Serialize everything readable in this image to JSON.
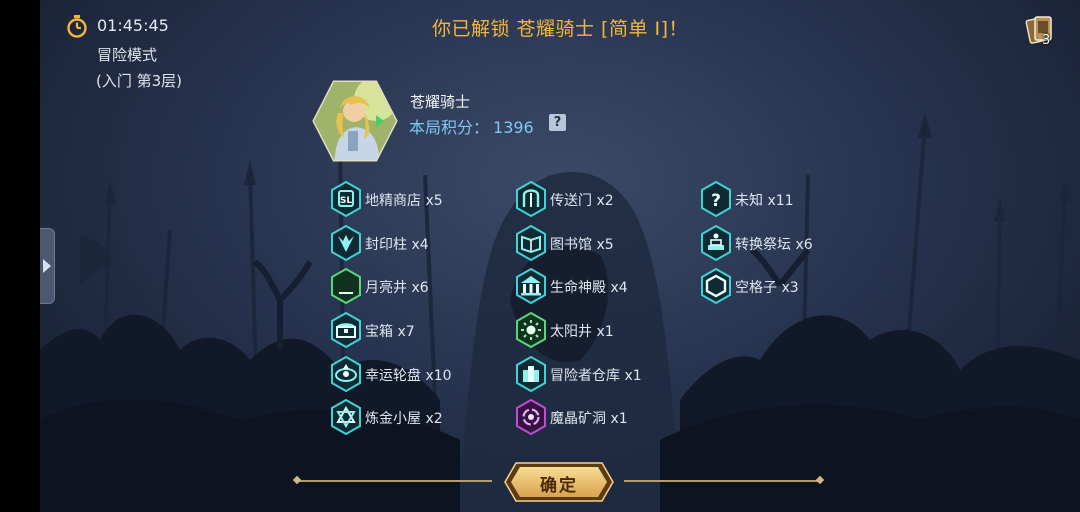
{
  "header": {
    "timer": "01:45:45",
    "mode": "冒险模式",
    "floor": "(入门 第3层)",
    "headline": "你已解锁 苍耀骑士 [简单 I]！",
    "card_count": "3"
  },
  "hero": {
    "name": "苍耀骑士",
    "score_label": "本局积分：",
    "score_value": "1396",
    "help": "?"
  },
  "rooms": [
    {
      "label": "地精商店 x5",
      "icon": "goblin-shop-icon"
    },
    {
      "label": "传送门 x2",
      "icon": "portal-icon"
    },
    {
      "label": "未知 x11",
      "icon": "unknown-icon"
    },
    {
      "label": "封印柱 x4",
      "icon": "seal-pillar-icon"
    },
    {
      "label": "图书馆 x5",
      "icon": "library-icon"
    },
    {
      "label": "转换祭坛 x6",
      "icon": "altar-icon"
    },
    {
      "label": "月亮井 x6",
      "icon": "moon-well-icon"
    },
    {
      "label": "生命神殿 x4",
      "icon": "life-temple-icon"
    },
    {
      "label": "空格子 x3",
      "icon": "empty-cell-icon"
    },
    {
      "label": "宝箱 x7",
      "icon": "chest-icon"
    },
    {
      "label": "太阳井 x1",
      "icon": "sun-well-icon"
    },
    {
      "label": "幸运轮盘 x10",
      "icon": "lucky-wheel-icon"
    },
    {
      "label": "冒险者仓库 x1",
      "icon": "warehouse-icon"
    },
    {
      "label": "炼金小屋 x2",
      "icon": "alchemy-icon"
    },
    {
      "label": "魔晶矿洞 x1",
      "icon": "crystal-mine-icon"
    }
  ],
  "confirm_label": "确定",
  "colors": {
    "headline": "#f3b53f",
    "score": "#7fc7f0",
    "icon_teal": "#3fd2d6",
    "icon_green": "#56d77a",
    "icon_purple": "#c14ad6",
    "button_gold": "#e8bf6e"
  }
}
